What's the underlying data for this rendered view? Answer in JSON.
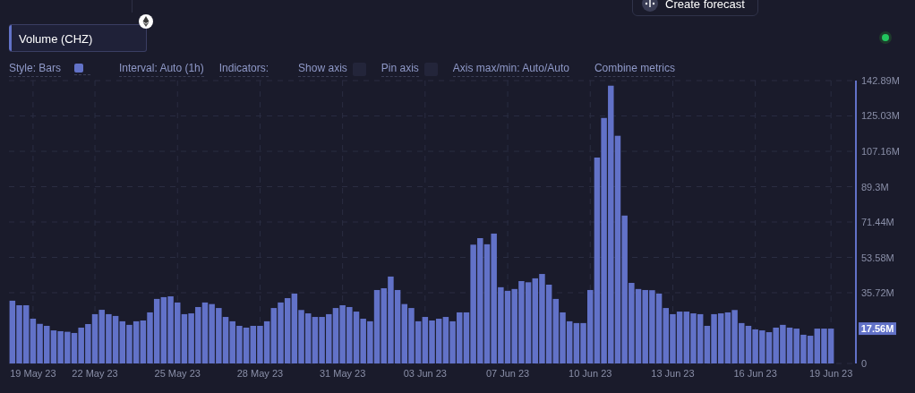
{
  "forecast_button": {
    "label": "Create forecast"
  },
  "metric": {
    "color": "#6272c8"
  },
  "status": {
    "color": "#22c55e"
  },
  "controls": [
    {
      "kind": "style",
      "label": "Style: Bars",
      "color": "#6272c8"
    },
    {
      "kind": "text",
      "label": "Interval: Auto (1h)"
    },
    {
      "kind": "text",
      "label": "Indicators:"
    },
    {
      "kind": "check",
      "label": "Show axis",
      "checked": false
    },
    {
      "kind": "check",
      "label": "Pin axis",
      "checked": false
    },
    {
      "kind": "text",
      "label": "Axis max/min: Auto/Auto"
    },
    {
      "kind": "text",
      "label": "Combine metrics"
    }
  ],
  "chart": {
    "last_value": "17.56M",
    "chart_data": {
      "type": "bar",
      "grid": true,
      "categories": [
        null,
        null,
        null,
        "19 May 23",
        null,
        null,
        null,
        null,
        null,
        null,
        null,
        null,
        "22 May 23",
        null,
        null,
        null,
        null,
        null,
        null,
        null,
        null,
        null,
        null,
        null,
        "25 May 23",
        null,
        null,
        null,
        null,
        null,
        null,
        null,
        null,
        null,
        null,
        null,
        "28 May 23",
        null,
        null,
        null,
        null,
        null,
        null,
        null,
        null,
        null,
        null,
        null,
        "31 May 23",
        null,
        null,
        null,
        null,
        null,
        null,
        null,
        null,
        null,
        null,
        null,
        "03 Jun 23",
        null,
        null,
        null,
        null,
        null,
        null,
        null,
        null,
        null,
        null,
        null,
        "07 Jun 23",
        null,
        null,
        null,
        null,
        null,
        null,
        null,
        null,
        null,
        null,
        null,
        "10 Jun 23",
        null,
        null,
        null,
        null,
        null,
        null,
        null,
        null,
        null,
        null,
        null,
        "13 Jun 23",
        null,
        null,
        null,
        null,
        null,
        null,
        null,
        null,
        null,
        null,
        null,
        "16 Jun 23",
        null,
        null,
        null,
        null,
        null,
        null,
        null,
        null,
        null,
        null,
        "19 Jun 23"
      ],
      "ylim": [
        0,
        142.89
      ],
      "yticks": [
        {
          "value": 0,
          "label": "0"
        },
        {
          "value": 35.72,
          "label": "35.72M"
        },
        {
          "value": 53.58,
          "label": "53.58M"
        },
        {
          "value": 71.44,
          "label": "71.44M"
        },
        {
          "value": 89.3,
          "label": "89.3M"
        },
        {
          "value": 107.16,
          "label": "107.16M"
        },
        {
          "value": 125.03,
          "label": "125.03M"
        },
        {
          "value": 142.89,
          "label": "142.89M"
        }
      ],
      "series": [
        {
          "name": "Volume (CHZ)",
          "color": "#6272c8",
          "values": [
            31.7,
            29.4,
            29.4,
            22.6,
            20,
            19,
            16.7,
            16.3,
            16,
            15.4,
            18.1,
            19.9,
            24.9,
            27.1,
            24.9,
            24,
            21.3,
            19.5,
            21.3,
            21.7,
            25.8,
            32.6,
            33.5,
            33.9,
            30.8,
            24.9,
            25.3,
            28.5,
            30.8,
            30,
            28,
            23.5,
            21.3,
            19,
            18.1,
            19,
            19,
            21.3,
            28,
            30.8,
            33,
            35.3,
            27,
            25.3,
            23.5,
            23.5,
            24.9,
            28,
            29.4,
            28.5,
            26.2,
            22.6,
            21.3,
            37.1,
            38,
            43.9,
            37.1,
            30,
            28,
            21.3,
            23.5,
            21.7,
            22.6,
            23.5,
            21.3,
            25.8,
            25.8,
            60,
            63.3,
            60.2,
            65.6,
            38.5,
            36.7,
            37.6,
            41.6,
            41,
            43,
            45.2,
            39.8,
            32.6,
            25.8,
            21.3,
            20.4,
            20.4,
            37.1,
            104,
            124,
            140.3,
            115,
            74.7,
            40.7,
            37.6,
            37.1,
            37,
            35.3,
            28,
            24.9,
            26.2,
            26.2,
            25.3,
            24.9,
            19,
            24.9,
            25.3,
            25.8,
            27,
            20.4,
            19,
            17.2,
            16.7,
            15.8,
            18.1,
            19.5,
            18.1,
            17.6,
            14.5,
            14,
            17.6,
            17.6,
            17.6
          ]
        }
      ]
    }
  }
}
